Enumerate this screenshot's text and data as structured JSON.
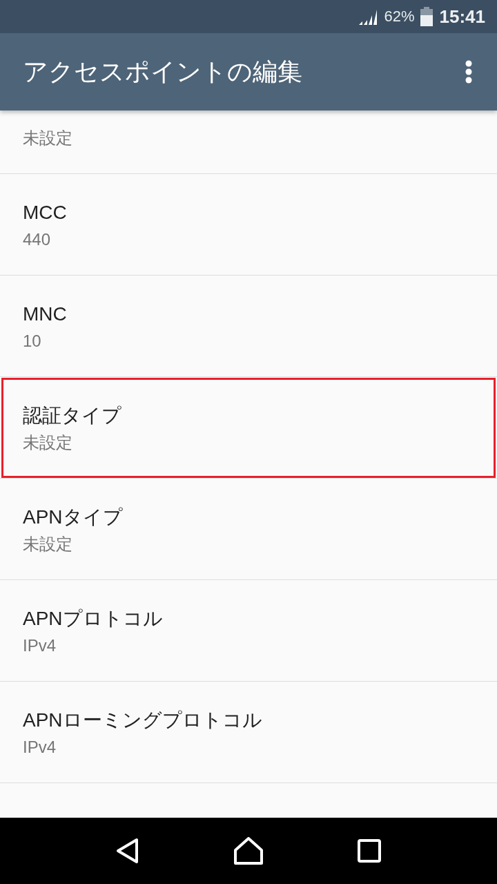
{
  "status_bar": {
    "battery": "62%",
    "time": "15:41"
  },
  "app_bar": {
    "title": "アクセスポイントの編集"
  },
  "settings": [
    {
      "value": "未設定",
      "highlighted": false
    },
    {
      "title": "MCC",
      "value": "440",
      "highlighted": false
    },
    {
      "title": "MNC",
      "value": "10",
      "highlighted": false
    },
    {
      "title": "認証タイプ",
      "value": "未設定",
      "highlighted": true
    },
    {
      "title": "APNタイプ",
      "value": "未設定",
      "highlighted": false
    },
    {
      "title": "APNプロトコル",
      "value": "IPv4",
      "highlighted": false
    },
    {
      "title": "APNローミングプロトコル",
      "value": "IPv4",
      "highlighted": false
    }
  ]
}
